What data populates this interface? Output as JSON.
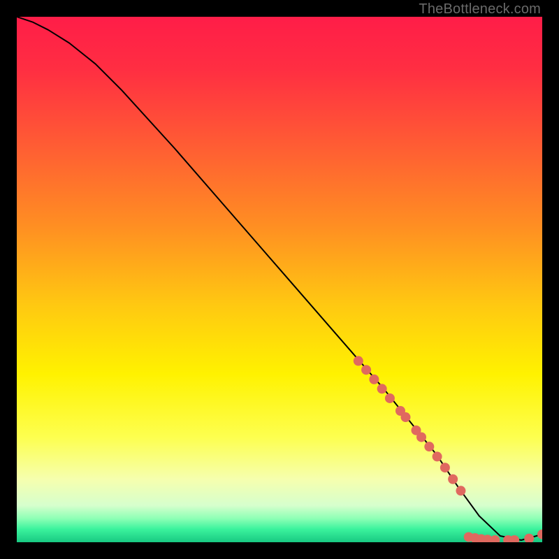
{
  "attribution": "TheBottleneck.com",
  "chart_data": {
    "type": "line",
    "title": "",
    "xlabel": "",
    "ylabel": "",
    "xlim": [
      0,
      100
    ],
    "ylim": [
      0,
      100
    ],
    "background_gradient_stops": [
      {
        "pos": 0.0,
        "color": "#ff1d48"
      },
      {
        "pos": 0.1,
        "color": "#ff2e42"
      },
      {
        "pos": 0.25,
        "color": "#ff5e33"
      },
      {
        "pos": 0.4,
        "color": "#ff8f22"
      },
      {
        "pos": 0.55,
        "color": "#ffc911"
      },
      {
        "pos": 0.68,
        "color": "#fff200"
      },
      {
        "pos": 0.8,
        "color": "#fdff4f"
      },
      {
        "pos": 0.88,
        "color": "#f6ffae"
      },
      {
        "pos": 0.93,
        "color": "#d6ffcd"
      },
      {
        "pos": 0.955,
        "color": "#8dffb5"
      },
      {
        "pos": 0.975,
        "color": "#3bf39d"
      },
      {
        "pos": 1.0,
        "color": "#18c982"
      }
    ],
    "series": [
      {
        "name": "bottleneck-curve",
        "x": [
          0,
          3,
          6,
          10,
          15,
          20,
          30,
          40,
          50,
          60,
          70,
          78,
          80,
          84,
          88,
          92,
          96,
          100
        ],
        "y": [
          100,
          99,
          97.5,
          95,
          91,
          86,
          75,
          63.5,
          52,
          40.5,
          29,
          19,
          16.5,
          10.5,
          5.0,
          1.2,
          0.4,
          1.5
        ]
      }
    ],
    "markers": [
      {
        "name": "marker-cluster",
        "x": 65,
        "y": 34.5
      },
      {
        "name": "marker-cluster",
        "x": 66.5,
        "y": 32.8
      },
      {
        "name": "marker-cluster",
        "x": 68,
        "y": 31
      },
      {
        "name": "marker-cluster",
        "x": 69.5,
        "y": 29.2
      },
      {
        "name": "marker-cluster",
        "x": 71,
        "y": 27.4
      },
      {
        "name": "marker-cluster",
        "x": 73,
        "y": 25
      },
      {
        "name": "marker-cluster",
        "x": 74,
        "y": 23.8
      },
      {
        "name": "marker-cluster",
        "x": 76,
        "y": 21.3
      },
      {
        "name": "marker-cluster",
        "x": 77,
        "y": 20
      },
      {
        "name": "marker-cluster",
        "x": 78.5,
        "y": 18.2
      },
      {
        "name": "marker-cluster",
        "x": 80,
        "y": 16.3
      },
      {
        "name": "marker-cluster",
        "x": 81.5,
        "y": 14.2
      },
      {
        "name": "marker-cluster",
        "x": 83,
        "y": 12
      },
      {
        "name": "marker-cluster",
        "x": 84.5,
        "y": 9.8
      },
      {
        "name": "marker-bottom",
        "x": 86,
        "y": 1.0
      },
      {
        "name": "marker-bottom",
        "x": 87.2,
        "y": 0.8
      },
      {
        "name": "marker-bottom",
        "x": 88.4,
        "y": 0.6
      },
      {
        "name": "marker-bottom",
        "x": 89.6,
        "y": 0.5
      },
      {
        "name": "marker-bottom",
        "x": 91,
        "y": 0.4
      },
      {
        "name": "marker-bottom",
        "x": 93.5,
        "y": 0.4
      },
      {
        "name": "marker-bottom",
        "x": 94.7,
        "y": 0.4
      },
      {
        "name": "marker-bottom",
        "x": 97.5,
        "y": 0.7
      },
      {
        "name": "marker-end",
        "x": 100,
        "y": 1.5
      }
    ],
    "marker_style": {
      "radius": 7,
      "fill": "#e0695f"
    },
    "curve_style": {
      "stroke": "#000000",
      "width": 2
    }
  }
}
